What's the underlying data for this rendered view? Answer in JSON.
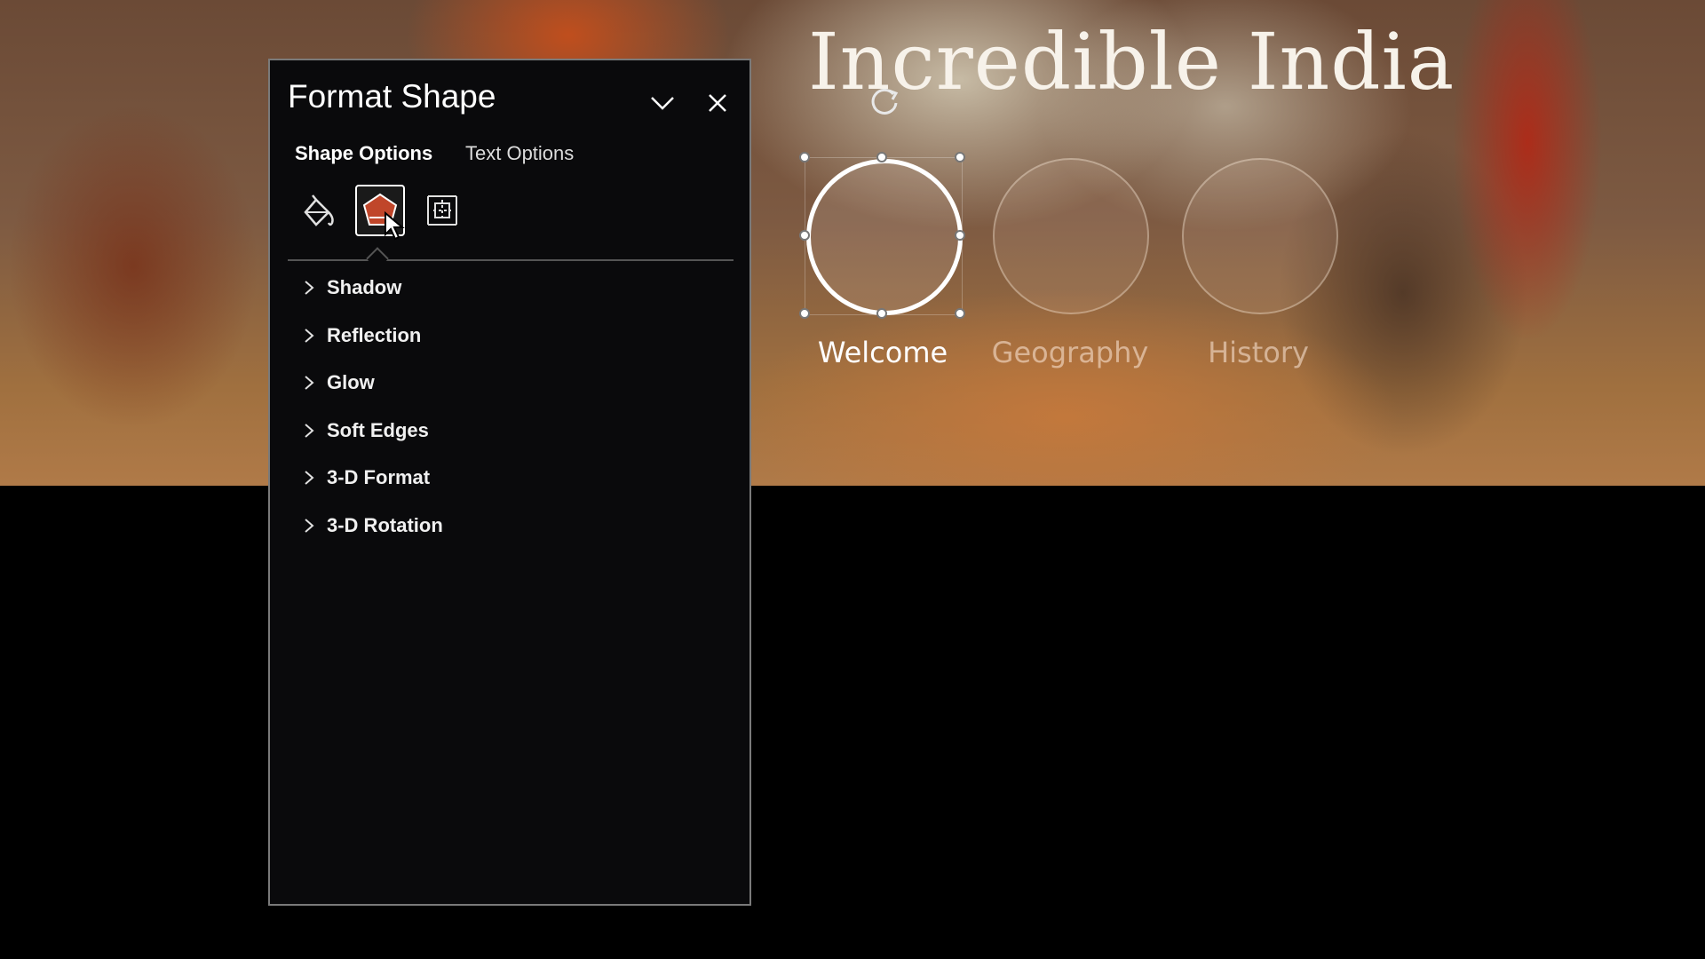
{
  "slide": {
    "title": "Incredible India",
    "nav": [
      {
        "label": "Welcome",
        "active": true
      },
      {
        "label": "Geography",
        "active": false
      },
      {
        "label": "History",
        "active": false
      }
    ]
  },
  "pane": {
    "title": "Format Shape",
    "tabs": {
      "shape_options": "Shape Options",
      "text_options": "Text Options"
    },
    "icon_tabs": [
      "fill-line-icon",
      "effects-icon",
      "size-properties-icon"
    ],
    "selected_icon_tab": "effects-icon",
    "sections": [
      "Shadow",
      "Reflection",
      "Glow",
      "Soft Edges",
      "3-D Format",
      "3-D Rotation"
    ]
  },
  "colors": {
    "accent": "#c0462a",
    "pane_bg": "#0a0a0c"
  }
}
